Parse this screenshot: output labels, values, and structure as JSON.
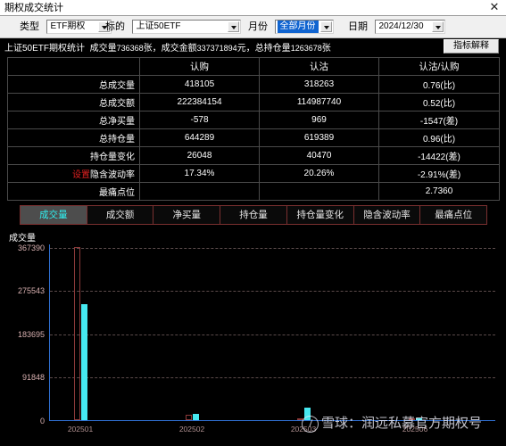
{
  "window": {
    "title": "期权成交统计",
    "close_icon": "close-icon"
  },
  "toolbar": {
    "type_label": "类型",
    "type_value": "ETF期权",
    "underlying_label": "标的",
    "underlying_value": "上证50ETF",
    "month_label": "月份",
    "month_value": "全部月份",
    "date_label": "日期",
    "date_value": "2024/12/30"
  },
  "summary": {
    "prefix": "上证50ETF期权统计",
    "volume_label": "成交量",
    "volume_value": "736368",
    "volume_unit": "张，",
    "amount_label": "成交金额",
    "amount_value": "337371894",
    "amount_unit": "元，",
    "oi_label": "总持仓量",
    "oi_value": "1263678",
    "oi_unit": "张",
    "explain_button": "指标解释"
  },
  "table": {
    "headers": [
      "",
      "认购",
      "认沽",
      "认沽/认购"
    ],
    "rows": [
      {
        "label": "总成交量",
        "call": "418105",
        "put": "318263",
        "ratio": "0.76(比)"
      },
      {
        "label": "总成交额",
        "call": "222384154",
        "put": "114987740",
        "ratio": "0.52(比)"
      },
      {
        "label": "总净买量",
        "call": "-578",
        "put": "969",
        "ratio": "-1547(差)"
      },
      {
        "label": "总持仓量",
        "call": "644289",
        "put": "619389",
        "ratio": "0.96(比)"
      },
      {
        "label": "持仓量变化",
        "call": "26048",
        "put": "40470",
        "ratio": "-14422(差)"
      },
      {
        "label": "隐含波动率",
        "prefix": "设置",
        "call": "17.34%",
        "put": "20.26%",
        "ratio": "-2.91%(差)"
      },
      {
        "label": "最痛点位",
        "call": "",
        "put": "",
        "ratio": "2.7360"
      }
    ]
  },
  "tabs": [
    {
      "label": "成交量",
      "active": true
    },
    {
      "label": "成交额",
      "active": false
    },
    {
      "label": "净买量",
      "active": false
    },
    {
      "label": "持仓量",
      "active": false
    },
    {
      "label": "持仓量变化",
      "active": false
    },
    {
      "label": "隐含波动率",
      "active": false
    },
    {
      "label": "最痛点位",
      "active": false
    }
  ],
  "chart_data": {
    "type": "bar",
    "title": "",
    "ylabel": "成交量",
    "xlabel": "",
    "categories": [
      "202501",
      "202502",
      "202503",
      "202506"
    ],
    "series": [
      {
        "name": "认购",
        "color": "#8c3a3a",
        "values": [
          367390,
          11000,
          4500,
          1200
        ]
      },
      {
        "name": "认沽",
        "color": "#46e8f0",
        "values": [
          247000,
          13500,
          26000,
          1500
        ]
      }
    ],
    "ylim": [
      0,
      367390
    ],
    "yticks": [
      0,
      91848,
      183695,
      275543,
      367390
    ],
    "ytick_labels": [
      "0",
      "91848",
      "183695",
      "275543",
      "367390"
    ],
    "grid": true,
    "legend": "none"
  },
  "watermark": {
    "logo": "xueqiu-logo-icon",
    "text": "雪球：润远私募官方期权号"
  }
}
